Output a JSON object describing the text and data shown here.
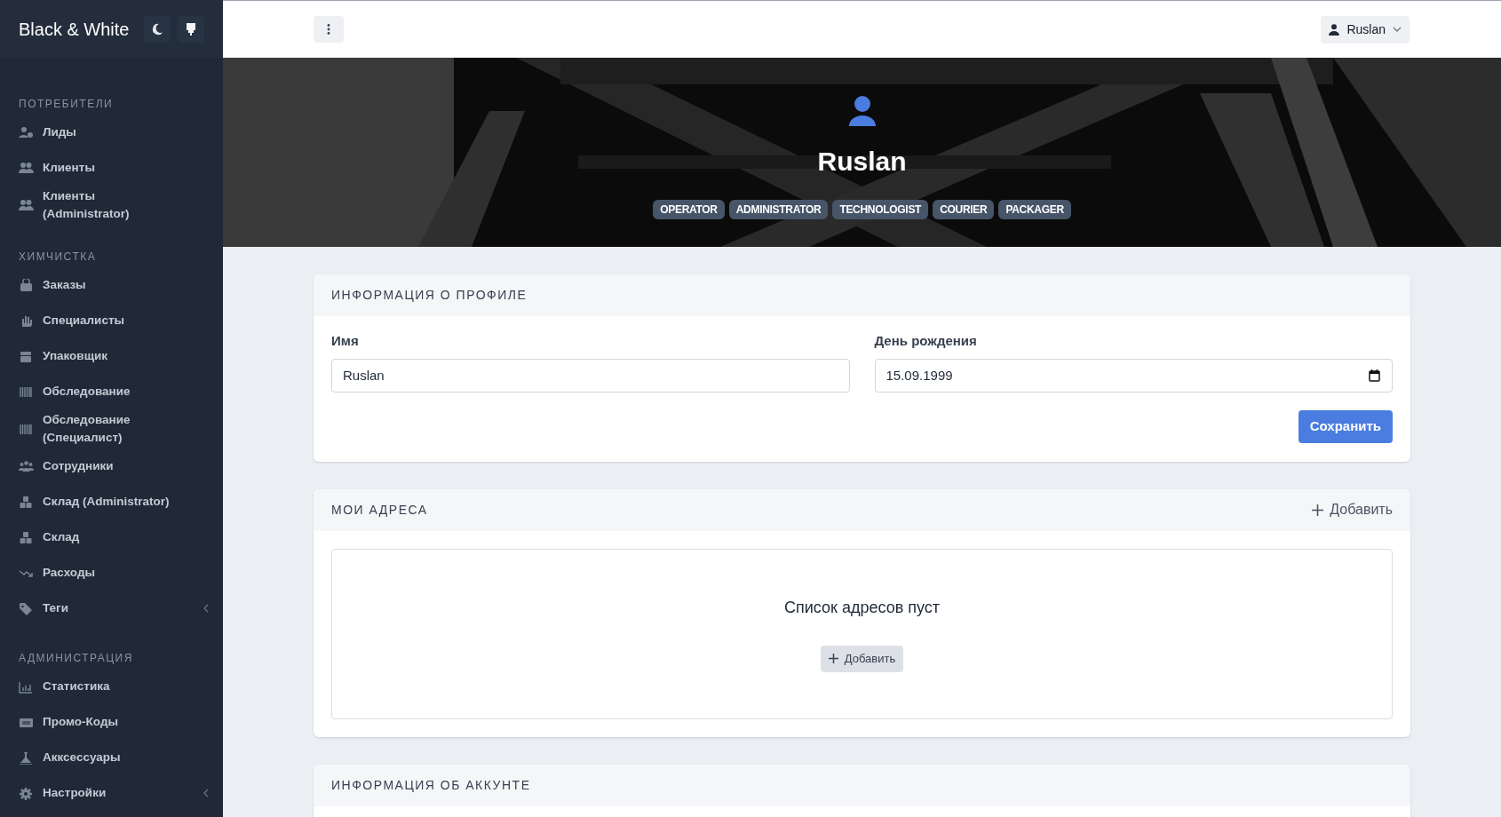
{
  "brand": {
    "title": "Black & White"
  },
  "sidebar": {
    "sections": [
      {
        "title": "ПОТРЕБИТЕЛИ",
        "items": [
          {
            "label": "Лиды",
            "submenu": false
          },
          {
            "label": "Клиенты",
            "submenu": false
          },
          {
            "label": "Клиенты (Administrator)",
            "submenu": false
          }
        ]
      },
      {
        "title": "ХИМЧИСТКА",
        "items": [
          {
            "label": "Заказы",
            "submenu": false
          },
          {
            "label": "Специалисты",
            "submenu": false
          },
          {
            "label": "Упаковщик",
            "submenu": false
          },
          {
            "label": "Обследование",
            "submenu": false
          },
          {
            "label": "Обследование (Специалист)",
            "submenu": false
          },
          {
            "label": "Сотрудники",
            "submenu": false
          },
          {
            "label": "Склад (Administrator)",
            "submenu": false
          },
          {
            "label": "Склад",
            "submenu": false
          },
          {
            "label": "Расходы",
            "submenu": false
          },
          {
            "label": "Теги",
            "submenu": true
          }
        ]
      },
      {
        "title": "АДМИНИСТРАЦИЯ",
        "items": [
          {
            "label": "Статистика",
            "submenu": false
          },
          {
            "label": "Промо-Коды",
            "submenu": false
          },
          {
            "label": "Акксессуары",
            "submenu": false
          },
          {
            "label": "Настройки",
            "submenu": true
          }
        ]
      }
    ]
  },
  "topbar": {
    "user": "Ruslan"
  },
  "hero": {
    "kind": "picture",
    "name": "Ruslan",
    "roles": [
      "OPERATOR",
      "ADMINISTRATOR",
      "TECHNOLOGIST",
      "COURIER",
      "PACKAGER"
    ]
  },
  "profile_card": {
    "title": "ИНФОРМАЦИЯ О ПРОФИЛЕ",
    "fields": [
      {
        "label": "Имя",
        "value": "Ruslan",
        "kind": "text"
      },
      {
        "label": "День рождения",
        "value": "15.09.1999",
        "kind": "date"
      }
    ],
    "save": "Сохранить"
  },
  "addresses_card": {
    "title": "МОИ АДРЕСА",
    "add": "Добавить",
    "empty_text": "Список адресов пуст",
    "empty_add": "Добавить"
  },
  "account_card": {
    "title": "ИНФОРМАЦИЯ ОБ АККУНТЕ"
  }
}
